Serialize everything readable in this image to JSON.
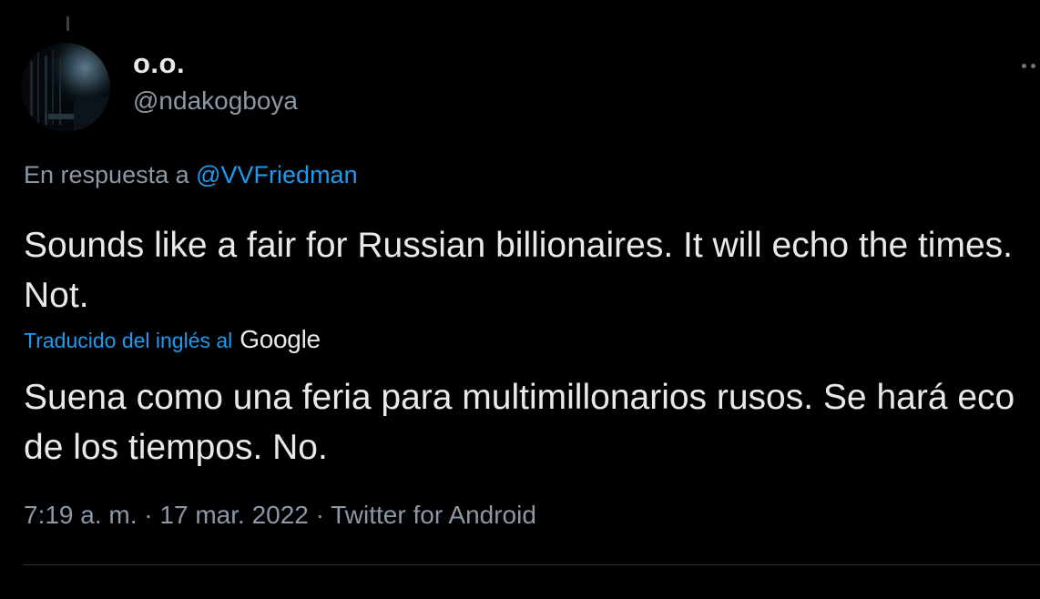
{
  "author": {
    "display_name": "o.o.",
    "handle": "@ndakogboya"
  },
  "reply": {
    "prefix": "En respuesta a ",
    "mention": "@VVFriedman"
  },
  "tweet": {
    "text": "Sounds like a fair for Russian billionaires. It will echo the times. Not."
  },
  "translation": {
    "label": "Traducido del inglés al",
    "provider": "Google",
    "text": "Suena como una feria para multimillonarios rusos. Se hará eco de los tiempos. No."
  },
  "meta": {
    "time": "7:19 a. m.",
    "separator": " · ",
    "date": "17 mar. 2022",
    "source": "Twitter for Android"
  },
  "icons": {
    "more": "more-horizontal-icon"
  },
  "colors": {
    "background": "#000000",
    "text": "#e7e9ea",
    "secondary": "#8b98a5",
    "accent": "#1d9bf0",
    "divider": "#2f3336"
  }
}
